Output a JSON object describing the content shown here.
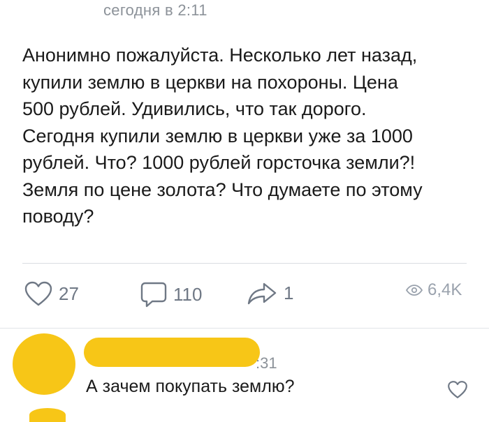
{
  "post": {
    "timestamp": "сегодня в 2:11",
    "text": "Анонимно пожалуйста. Несколько лет назад,\nкупили землю в церкви на похороны. Цена\n500 рублей. Удивились, что так дорого.\nСегодня купили землю в церкви уже за 1000\nрублей. Что? 1000 рублей горсточка земли?!\nЗемля по цене золота? Что думаете по этому\nповоду?",
    "likes": "27",
    "comments": "110",
    "shares": "1",
    "views": "6,4K"
  },
  "comment": {
    "time": ":31",
    "text": "А зачем покупать землю?"
  },
  "colors": {
    "redaction": "#f7c617",
    "icon_gray": "#6f7885",
    "meta_gray": "#8c9299"
  }
}
